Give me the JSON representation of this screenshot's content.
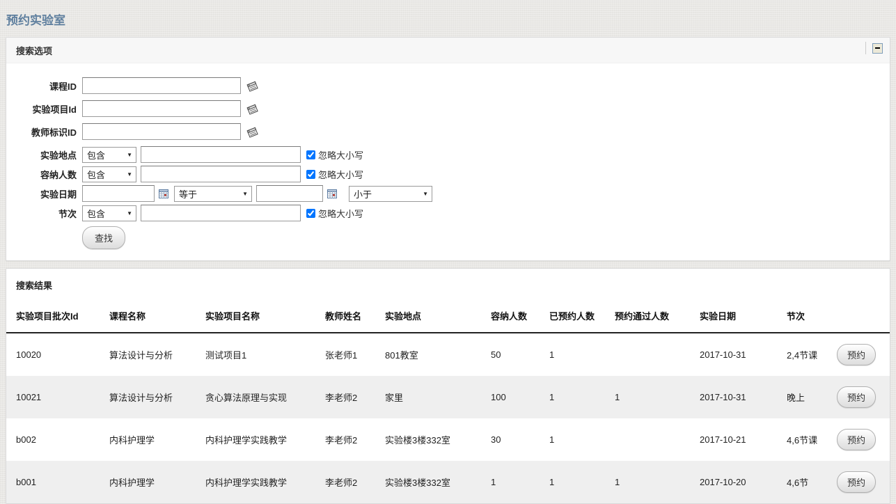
{
  "page": {
    "title": "预约实验室"
  },
  "colors": {
    "title_accent": "#60809f",
    "stripe": "#efefef",
    "header_rule": "#222222"
  },
  "search_panel": {
    "title": "搜索选项",
    "collapse_icon": "minus-box",
    "fields": {
      "course_id": {
        "label": "课程ID",
        "value": "",
        "picker_icon": "notepad"
      },
      "project_id": {
        "label": "实验项目Id",
        "value": "",
        "picker_icon": "notepad"
      },
      "teacher_id": {
        "label": "教师标识ID",
        "value": "",
        "picker_icon": "notepad"
      },
      "location": {
        "label": "实验地点",
        "operator": "包含",
        "value": "",
        "checkbox_label": "忽略大小写",
        "checked": "checked"
      },
      "capacity": {
        "label": "容纳人数",
        "operator": "包含",
        "value": "",
        "checkbox_label": "忽略大小写",
        "checked": "checked"
      },
      "date": {
        "label": "实验日期",
        "value1": "",
        "operator1": "等于",
        "value2": "",
        "operator2": "小于"
      },
      "period": {
        "label": "节次",
        "operator": "包含",
        "value": "",
        "checkbox_label": "忽略大小写",
        "checked": "checked"
      }
    },
    "search_button": "查找"
  },
  "results_panel": {
    "title": "搜索结果",
    "table": {
      "columns": [
        "实验项目批次Id",
        "课程名称",
        "实验项目名称",
        "教师姓名",
        "实验地点",
        "容纳人数",
        "已预约人数",
        "预约通过人数",
        "实验日期",
        "节次"
      ],
      "action_label": "预约",
      "rows": [
        [
          "10020",
          "算法设计与分析",
          "测试项目1",
          "张老师1",
          "801教室",
          "50",
          "1",
          "",
          "2017-10-31",
          "2,4节课"
        ],
        [
          "10021",
          "算法设计与分析",
          "贪心算法原理与实现",
          "李老师2",
          "家里",
          "100",
          "1",
          "1",
          "2017-10-31",
          "晚上"
        ],
        [
          "b002",
          "内科护理学",
          "内科护理学实践教学",
          "李老师2",
          "实验楼3楼332室",
          "30",
          "1",
          "",
          "2017-10-21",
          "4,6节课"
        ],
        [
          "b001",
          "内科护理学",
          "内科护理学实践教学",
          "李老师2",
          "实验楼3楼332室",
          "1",
          "1",
          "1",
          "2017-10-20",
          "4,6节"
        ]
      ]
    }
  }
}
